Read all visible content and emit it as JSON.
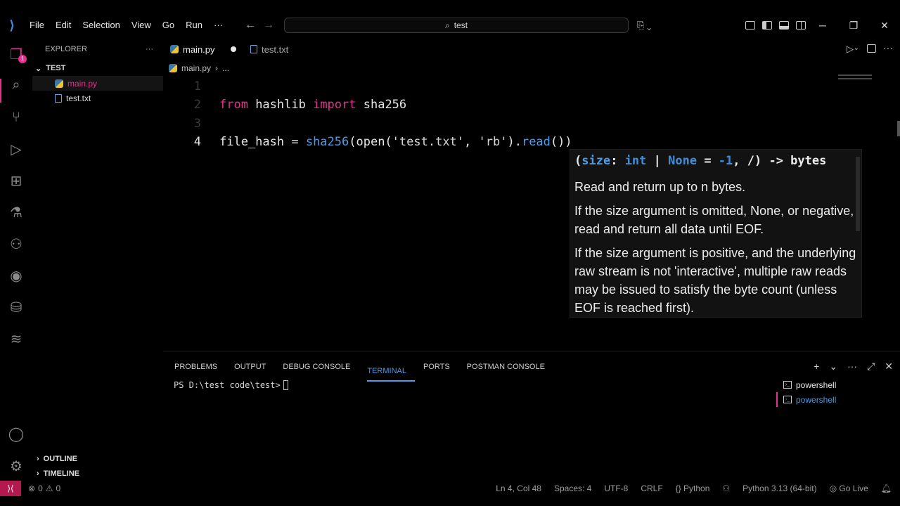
{
  "menu": [
    "File",
    "Edit",
    "Selection",
    "View",
    "Go",
    "Run",
    "···"
  ],
  "search": {
    "text": "test"
  },
  "activity": {
    "explorer_badge": "1"
  },
  "sidebar": {
    "title": "EXPLORER",
    "more": "···",
    "folder": "TEST",
    "files": [
      "main.py",
      "test.txt"
    ],
    "outline": "OUTLINE",
    "timeline": "TIMELINE"
  },
  "tabs": [
    {
      "label": "main.py",
      "modified": true
    },
    {
      "label": "test.txt"
    }
  ],
  "breadcrumb": {
    "file": "main.py",
    "sep": "›",
    "more": "..."
  },
  "code": {
    "line_numbers": [
      "1",
      "2",
      "3",
      "4"
    ],
    "line2": {
      "kw1": "from",
      "mod": " hashlib ",
      "kw2": "import",
      "name": " sha256"
    },
    "line4": {
      "var": "file_hash = ",
      "fn": "sha256",
      "p1": "(open(",
      "s1": "'test.txt'",
      "comma": ", ",
      "s2": "'rb'",
      "p2": ").",
      "fn2": "read",
      "p3": "())"
    }
  },
  "hover": {
    "sig_open": "(",
    "sig_param": "size",
    "sig_colon": ": ",
    "sig_type": "int",
    "sig_pipe": " | ",
    "sig_none": "None",
    "sig_eq": " = ",
    "sig_val": "-1",
    "sig_rest": ", /) -> bytes",
    "doc1": "Read and return up to n bytes.",
    "doc2": "If the size argument is omitted, None, or negative, read and return all data until EOF.",
    "doc3": "If the size argument is positive, and the underlying raw stream is not 'interactive', multiple raw reads may be issued to satisfy the byte count (unless EOF is reached first)."
  },
  "panel": {
    "tabs": [
      "PROBLEMS",
      "OUTPUT",
      "DEBUG CONSOLE",
      "TERMINAL",
      "PORTS",
      "POSTMAN CONSOLE"
    ],
    "active_tab": "TERMINAL",
    "prompt": "PS D:\\test code\\test>",
    "terminals": [
      "powershell",
      "powershell"
    ]
  },
  "status": {
    "errors": "0",
    "warnings": "0",
    "position": "Ln 4, Col 48",
    "spaces": "Spaces: 4",
    "encoding": "UTF-8",
    "eol": "CRLF",
    "language": "Python",
    "interpreter": "Python 3.13 (64-bit)",
    "live": "Go Live"
  },
  "colors": {
    "accent_pink": "#e4308f",
    "accent_blue": "#4a9be8",
    "background": "#000000"
  }
}
